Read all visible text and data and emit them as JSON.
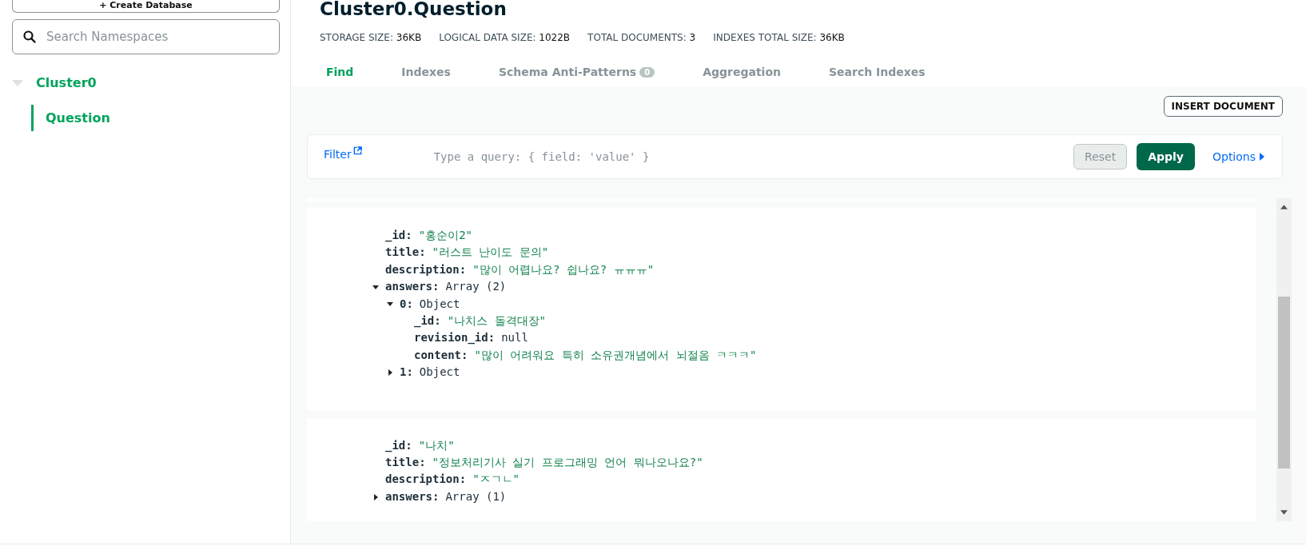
{
  "sidebar": {
    "create_button": "+ Create Database",
    "search": {
      "placeholder": "Search Namespaces"
    },
    "tree": [
      {
        "label": "Cluster0",
        "expanded": true,
        "children": [
          {
            "label": "Question",
            "selected": true
          }
        ]
      }
    ]
  },
  "header": {
    "title": "Cluster0.Question",
    "stats": [
      {
        "label": "STORAGE SIZE:",
        "value": "36KB"
      },
      {
        "label": "LOGICAL DATA SIZE:",
        "value": "1022B"
      },
      {
        "label": "TOTAL DOCUMENTS:",
        "value": "3"
      },
      {
        "label": "INDEXES TOTAL SIZE:",
        "value": "36KB"
      }
    ],
    "tabs": [
      {
        "label": "Find",
        "selected": true
      },
      {
        "label": "Indexes",
        "selected": false
      },
      {
        "label": "Schema Anti-Patterns",
        "badge": "0",
        "selected": false
      },
      {
        "label": "Aggregation",
        "selected": false
      },
      {
        "label": "Search Indexes",
        "selected": false
      }
    ]
  },
  "toolbar": {
    "insert_button": "INSERT DOCUMENT"
  },
  "filter": {
    "label": "Filter",
    "placeholder": "Type a query: { field: 'value' }",
    "reset": "Reset",
    "apply": "Apply",
    "options": "Options"
  },
  "documents": [
    {
      "fields": [
        {
          "key": "_id:",
          "kind": "string",
          "value": "\"홍순이2\""
        },
        {
          "key": "title:",
          "kind": "string",
          "value": "\"러스트 난이도 문의\""
        },
        {
          "key": "description:",
          "kind": "string",
          "value": "\"많이 어렵나요? 쉽나요? ㅠㅠㅠ\""
        },
        {
          "key": "answers:",
          "kind": "type",
          "value": "Array (2)",
          "expanded": true,
          "children": [
            {
              "key": "0:",
              "kind": "type",
              "value": "Object",
              "expanded": true,
              "children": [
                {
                  "key": "_id:",
                  "kind": "string",
                  "value": "\"나치스 돌격대장\""
                },
                {
                  "key": "revision_id:",
                  "kind": "type",
                  "value": "null"
                },
                {
                  "key": "content:",
                  "kind": "string",
                  "value": "\"많이 어려워요 특히 소유권개념에서 뇌절옴 ㅋㅋㅋ\""
                }
              ]
            },
            {
              "key": "1:",
              "kind": "type",
              "value": "Object",
              "expanded": false
            }
          ]
        }
      ]
    },
    {
      "fields": [
        {
          "key": "_id:",
          "kind": "string",
          "value": "\"나치\""
        },
        {
          "key": "title:",
          "kind": "string",
          "value": "\"정보처리기사 실기 프로그래밍 언어 뭐나오나요?\""
        },
        {
          "key": "description:",
          "kind": "string",
          "value": "\"ㅈㄱㄴ\""
        },
        {
          "key": "answers:",
          "kind": "type",
          "value": "Array (1)",
          "expanded": false
        }
      ]
    }
  ]
}
